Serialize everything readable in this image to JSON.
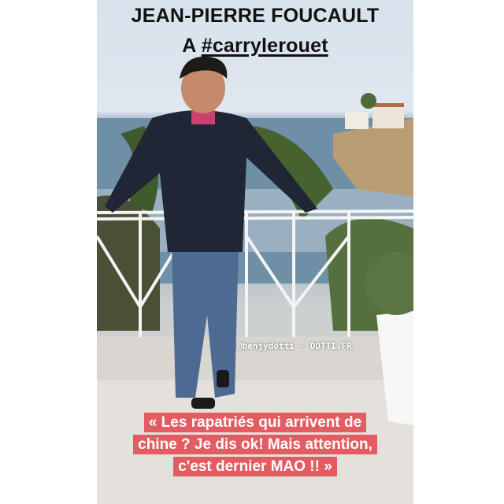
{
  "story": {
    "headline_line1": "JEAN-PIERRE FOUCAULT",
    "headline_prefix": "A ",
    "headline_hashtag": "#carrylerouet",
    "credit": "@benjydotti - DOTTI.FR",
    "quote_lines": [
      "« Les rapatriés qui arrivent de",
      "chine ? Je dis ok! Mais attention,",
      "c'est dernier MAO !! »"
    ]
  },
  "colors": {
    "quote_background": "#e25c62",
    "headline_text": "#111111",
    "page_background": "#ffffff"
  }
}
